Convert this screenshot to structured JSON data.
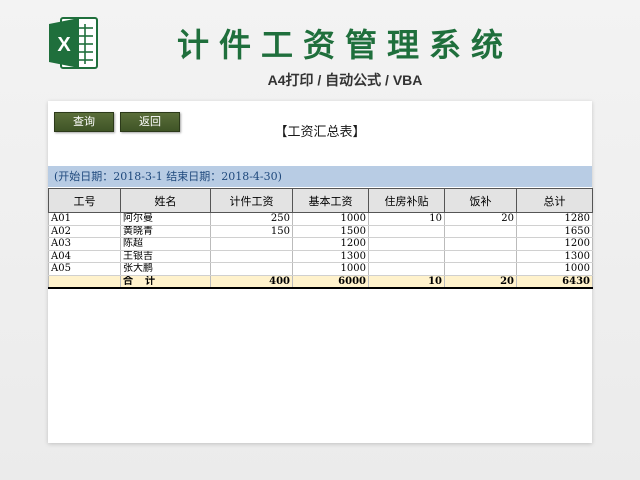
{
  "header": {
    "title": "计件工资管理系统",
    "subtitle": "A4打印 / 自动公式 / VBA",
    "logo_icon": "excel-icon",
    "logo_letter": "X",
    "brand_color": "#1f6f3c"
  },
  "toolbar": {
    "query_label": "查询",
    "back_label": "返回"
  },
  "report": {
    "title": "【工资汇总表】",
    "date_range": "(开始日期：2018-3-1  结束日期：2018-4-30)"
  },
  "table": {
    "columns": [
      "工号",
      "姓名",
      "计件工资",
      "基本工资",
      "住房补贴",
      "饭补",
      "总计"
    ],
    "rows": [
      [
        "A01",
        "阿尔曼",
        "250",
        "1000",
        "10",
        "20",
        "1280"
      ],
      [
        "A02",
        "黄晓青",
        "150",
        "1500",
        "",
        "",
        "1650"
      ],
      [
        "A03",
        "陈超",
        "",
        "1200",
        "",
        "",
        "1200"
      ],
      [
        "A04",
        "王银吉",
        "",
        "1300",
        "",
        "",
        "1300"
      ],
      [
        "A05",
        "张大鹏",
        "",
        "1000",
        "",
        "",
        "1000"
      ]
    ],
    "total": [
      "",
      "合　计",
      "400",
      "6000",
      "10",
      "20",
      "6430"
    ]
  }
}
